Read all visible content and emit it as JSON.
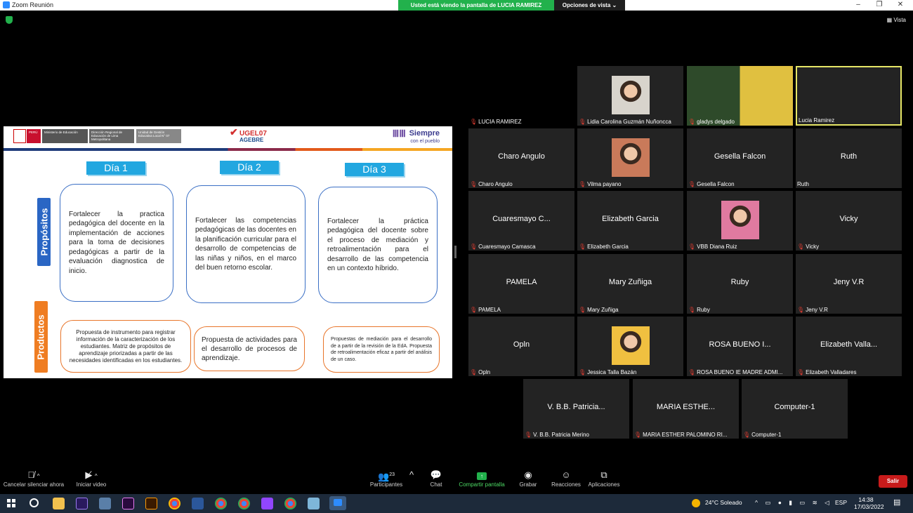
{
  "window": {
    "title": "Zoom Reunión",
    "banner": "Usted está viendo la pantalla de LUCIA RAMIREZ",
    "view_options": "Opciones de vista ⌄",
    "min": "–",
    "restore": "❐",
    "close": "✕"
  },
  "view_button": "Vista",
  "slide": {
    "header": {
      "peru": "PERÚ",
      "ministerio": "Ministerio de Educación",
      "direccion": "Dirección Regional de Educación de Lima Metropolitana",
      "unidad": "Unidad de Gestión Educativa Local N° 07",
      "ugel": "UGEL07",
      "agebre": "AGEBRE",
      "siempre": "Siempre",
      "con_el_pueblo": "con el pueblo"
    },
    "propositos_label": "Propósitos",
    "productos_label": "Productos",
    "days": [
      "Día 1",
      "Día 2",
      "Día 3"
    ],
    "purposes": [
      "Fortalecer la practica pedagógica del docente en la implementación de acciones para la toma de decisiones pedagógicas a partir de la evaluación diagnostica de inicio.",
      "Fortalecer las competencias pedagógicas de las docentes en la planificación curricular para el desarrollo de competencias de las niñas y niños, en el marco del buen retorno escolar.",
      "Fortalecer la práctica pedagógica del docente sobre el proceso de mediación y retroalimentación para el desarrollo de las competencia en un contexto híbrido."
    ],
    "products": [
      "Propuesta de instrumento para registrar información de la caracterización de los estudiantes. Matriz de propósitos de aprendizaje priorizadas a partir de las necesidades identificadas en los estudiantes.",
      "Propuesta de actividades para el desarrollo de procesos de aprendizaje.",
      "Propuestas de mediación para el desarrollo de a partir de la revisión de la EdA. Propuesta de retroalimentación eficaz a partir del análisis de un caso."
    ]
  },
  "participants": [
    {
      "big": "",
      "name": "LUCIA RAMIREZ"
    },
    {
      "big": "",
      "name": "Lidia Carolina Guzmán Nuñoncca"
    },
    {
      "big": "",
      "name": "gladys delgado"
    },
    {
      "big": "",
      "name": "Lucia Ramirez"
    },
    {
      "big": "Charo Angulo",
      "name": "Charo Angulo"
    },
    {
      "big": "",
      "name": "Vilma payano"
    },
    {
      "big": "Gesella Falcon",
      "name": "Gesella Falcon"
    },
    {
      "big": "Ruth",
      "name": "Ruth"
    },
    {
      "big": "Cuaresmayo  C...",
      "name": "Cuaresmayo Camasca"
    },
    {
      "big": "Elizabeth Garcia",
      "name": "Elizabeth Garcia"
    },
    {
      "big": "",
      "name": "VBB Diana Ruiz"
    },
    {
      "big": "Vicky",
      "name": "Vicky"
    },
    {
      "big": "PAMELA",
      "name": "PAMELA"
    },
    {
      "big": "Mary Zuñiga",
      "name": "Mary Zuñiga"
    },
    {
      "big": "Ruby",
      "name": "Ruby"
    },
    {
      "big": "Jeny V.R",
      "name": "Jeny V.R"
    },
    {
      "big": "Opln",
      "name": "Opln"
    },
    {
      "big": "",
      "name": "Jessica Talla Bazán"
    },
    {
      "big": "ROSA BUENO I...",
      "name": "ROSA BUENO IE MADRE ADMI..."
    },
    {
      "big": "Elizabeth  Valla...",
      "name": "Elizabeth Valladares"
    },
    {
      "big": "V. B.B. Patricia...",
      "name": "V. B.B. Patricia Merino"
    },
    {
      "big": "MARIA  ESTHE...",
      "name": "MARIA ESTHER PALOMINO RI..."
    },
    {
      "big": "Computer-1",
      "name": "Computer-1"
    }
  ],
  "toolbar": {
    "mute": "Cancelar silenciar ahora",
    "video": "Iniciar video",
    "participants": "Participantes",
    "participants_count": "23",
    "chat": "Chat",
    "share": "Compartir pantalla",
    "record": "Grabar",
    "reactions": "Reacciones",
    "apps": "Aplicaciones",
    "leave": "Salir"
  },
  "taskbar": {
    "weather": "24°C  Soleado",
    "lang": "ESP",
    "time": "14:38",
    "date": "17/03/2022"
  },
  "colors": {
    "share_green": "#22b14c",
    "leave_red": "#c81b1b",
    "muted_red": "#e03c31",
    "active_border": "#e6e666"
  }
}
